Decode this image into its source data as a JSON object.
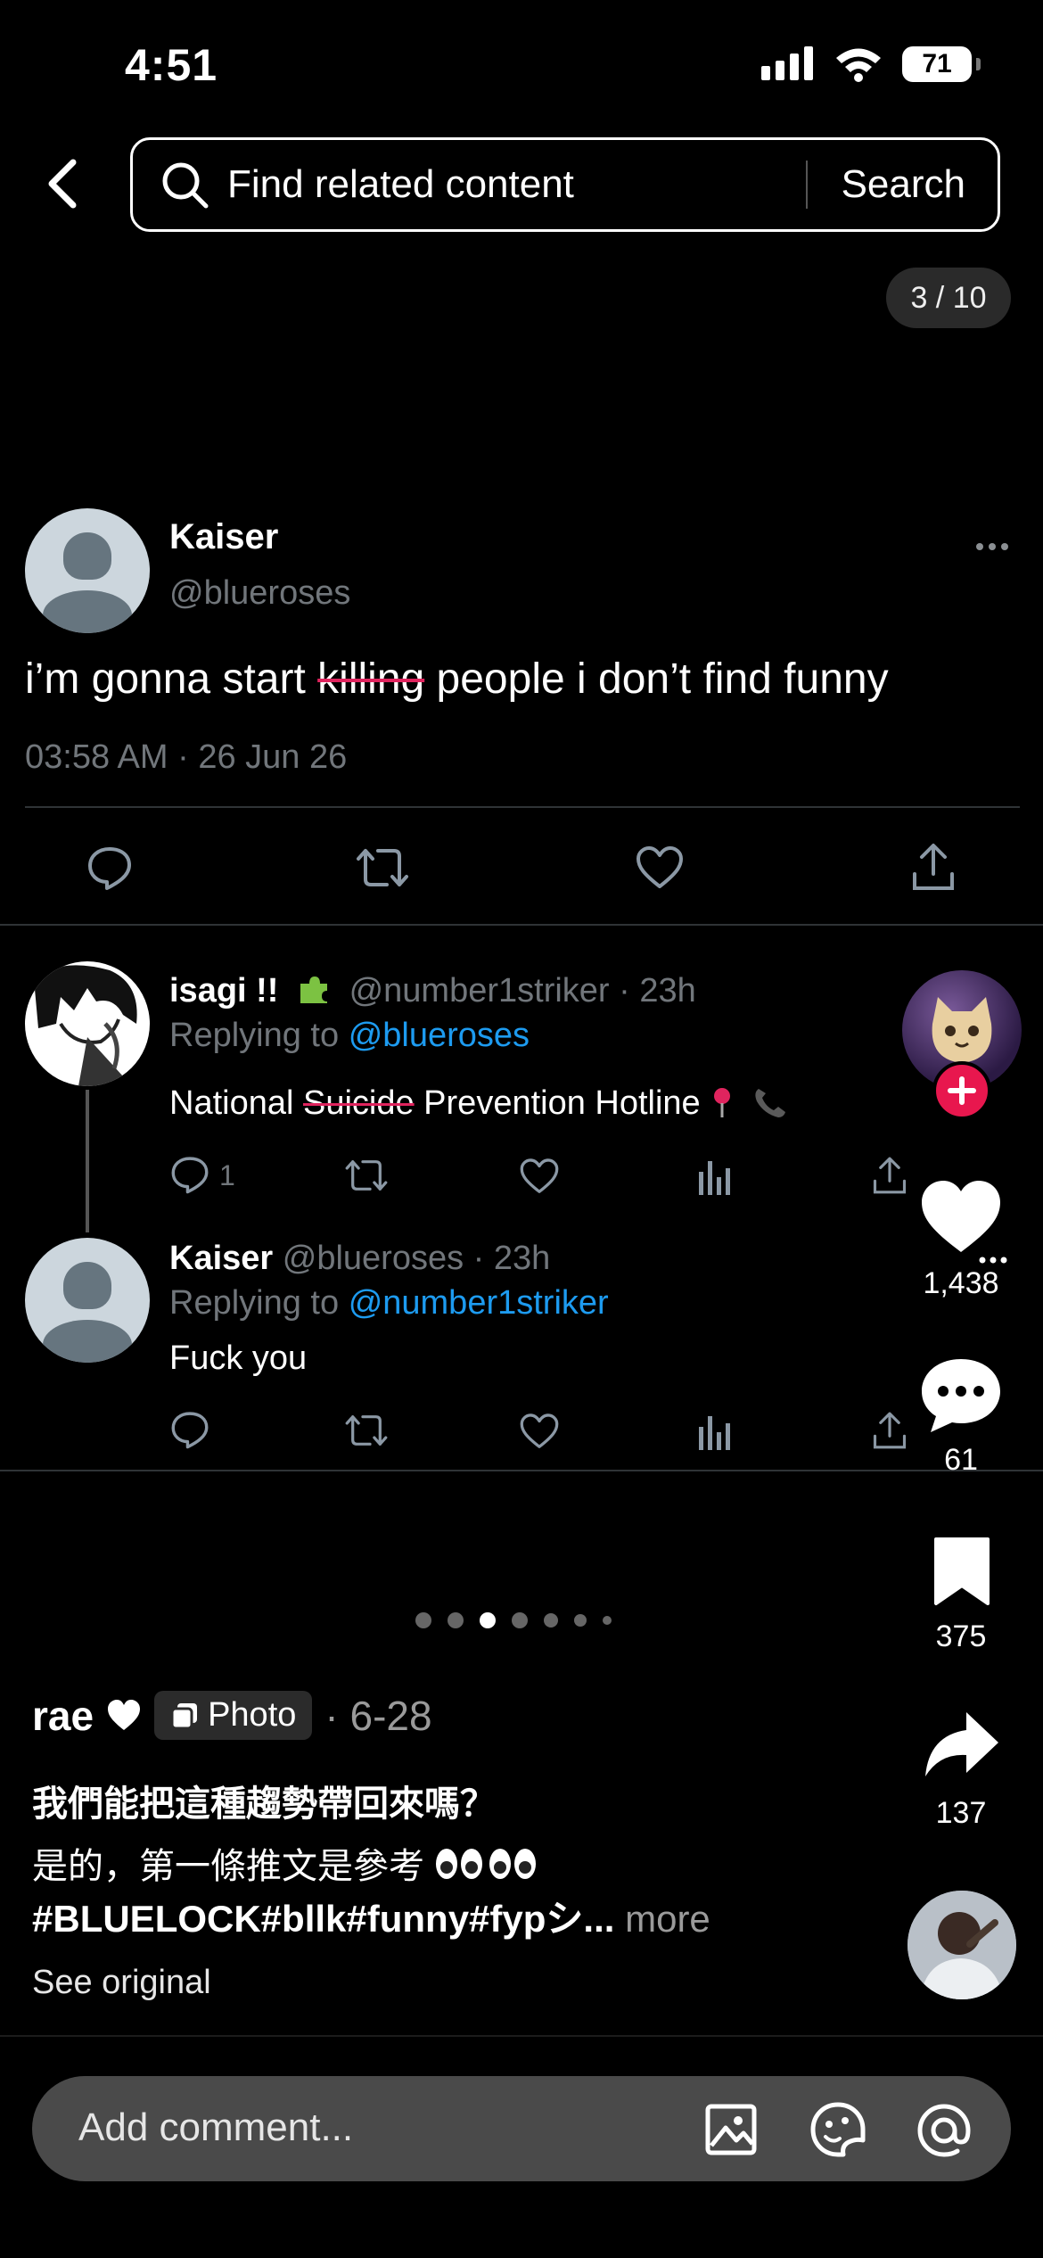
{
  "status_bar": {
    "time": "4:51",
    "battery": "71"
  },
  "search": {
    "placeholder": "Find related content",
    "button": "Search"
  },
  "page_counter": "3 / 10",
  "tweet": {
    "name": "Kaiser",
    "handle": "@blueroses",
    "text_pre": "i’m gonna start ",
    "text_strike": "killing",
    "text_post": " people i don’t find funny",
    "timestamp": "03:58 AM · 26 Jun 26"
  },
  "replies": [
    {
      "name": "isagi !!",
      "handle": "@number1striker · 23h",
      "replying_to_label": "Replying to",
      "replying_to": "@blueroses",
      "text_pre": "National ",
      "text_strike": "Suicide",
      "text_post": " Prevention Hotline",
      "reply_count": "1"
    },
    {
      "name": "Kaiser",
      "handle": "@blueroses · 23h",
      "replying_to_label": "Replying to",
      "replying_to": "@number1striker",
      "text": "Fuck you"
    }
  ],
  "rail": {
    "likes": "1,438",
    "comments": "61",
    "saves": "375",
    "shares": "137"
  },
  "caption": {
    "author": "rae",
    "chip": "Photo",
    "date": "· 6-28",
    "title": "我們能把這種趨勢帶回來嗎？",
    "body_line1": "是的，第一條推文是參考",
    "body_line2": "#BLUELOCK#bllk#funny#fypシ...",
    "more": "more",
    "see_original": "See original"
  },
  "comment_bar": {
    "placeholder": "Add comment..."
  },
  "carousel": {
    "count": 7,
    "active": 3
  }
}
